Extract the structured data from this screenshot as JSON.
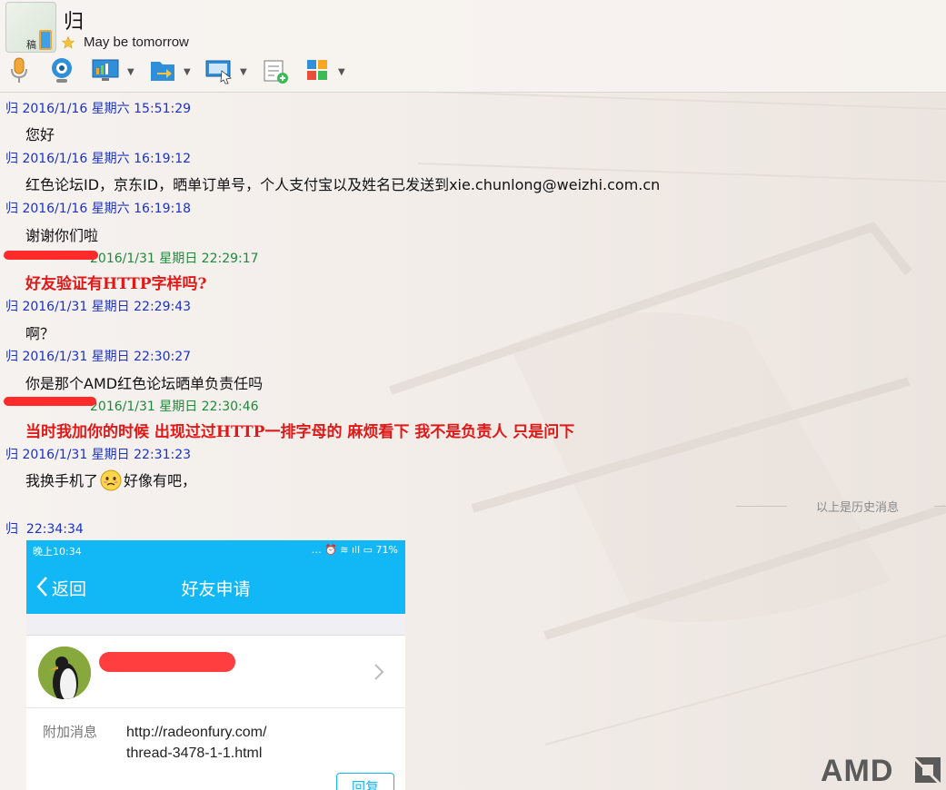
{
  "header": {
    "contact_name": "归",
    "signature": "May be tomorrow",
    "avatar_mark": "稿"
  },
  "toolbar": {
    "icons": [
      "microphone-icon",
      "webcam-icon",
      "screen-share-icon",
      "file-transfer-icon",
      "remote-desktop-icon",
      "new-note-icon",
      "apps-icon"
    ]
  },
  "messages": [
    {
      "sender": "归",
      "time": "2016/1/16 星期六 15:51:29",
      "text": "您好"
    },
    {
      "sender": "归",
      "time": "2016/1/16 星期六 16:19:12",
      "text": "红色论坛ID，京东ID，晒单订单号，个人支付宝以及姓名已发送到xie.chunlong@weizhi.com.cn"
    },
    {
      "sender": "归",
      "time": "2016/1/16 星期六 16:19:18",
      "text": "谢谢你们啦"
    },
    {
      "sender": "",
      "time": "2016/1/31 星期日 22:29:17",
      "text": "好友验证有HTTP字样吗?"
    },
    {
      "sender": "归",
      "time": "2016/1/31 星期日 22:29:43",
      "text": "啊？"
    },
    {
      "sender": "归",
      "time": "2016/1/31 星期日 22:30:27",
      "text": "你是那个AMD红色论坛晒单负责任吗"
    },
    {
      "sender": "",
      "time": "2016/1/31 星期日 22:30:46",
      "text": "当时我加你的时候  出现过过HTTP一排字母的  麻烦看下  我不是负责人  只是问下"
    },
    {
      "sender": "归",
      "time": "2016/1/31 星期日 22:31:23",
      "text_before": "我换手机了",
      "text_after": "好像有吧，"
    },
    {
      "sender": "归",
      "time": "22:34:34"
    }
  ],
  "history_divider": "以上是历史消息",
  "screenshot": {
    "status_time": "晚上10:34",
    "status_battery": "71%",
    "back_label": "返回",
    "title": "好友申请",
    "extra_label": "附加消息",
    "extra_value_line1": "http://radeonfury.com/",
    "extra_value_line2": "thread-3478-1-1.html",
    "reply_label": "回复"
  },
  "watermark": "AMD",
  "colors": {
    "self_time": "#1a32c9",
    "other_time": "#1f8a3c",
    "other_text": "#e01818",
    "mobile_accent": "#12b7f5"
  }
}
